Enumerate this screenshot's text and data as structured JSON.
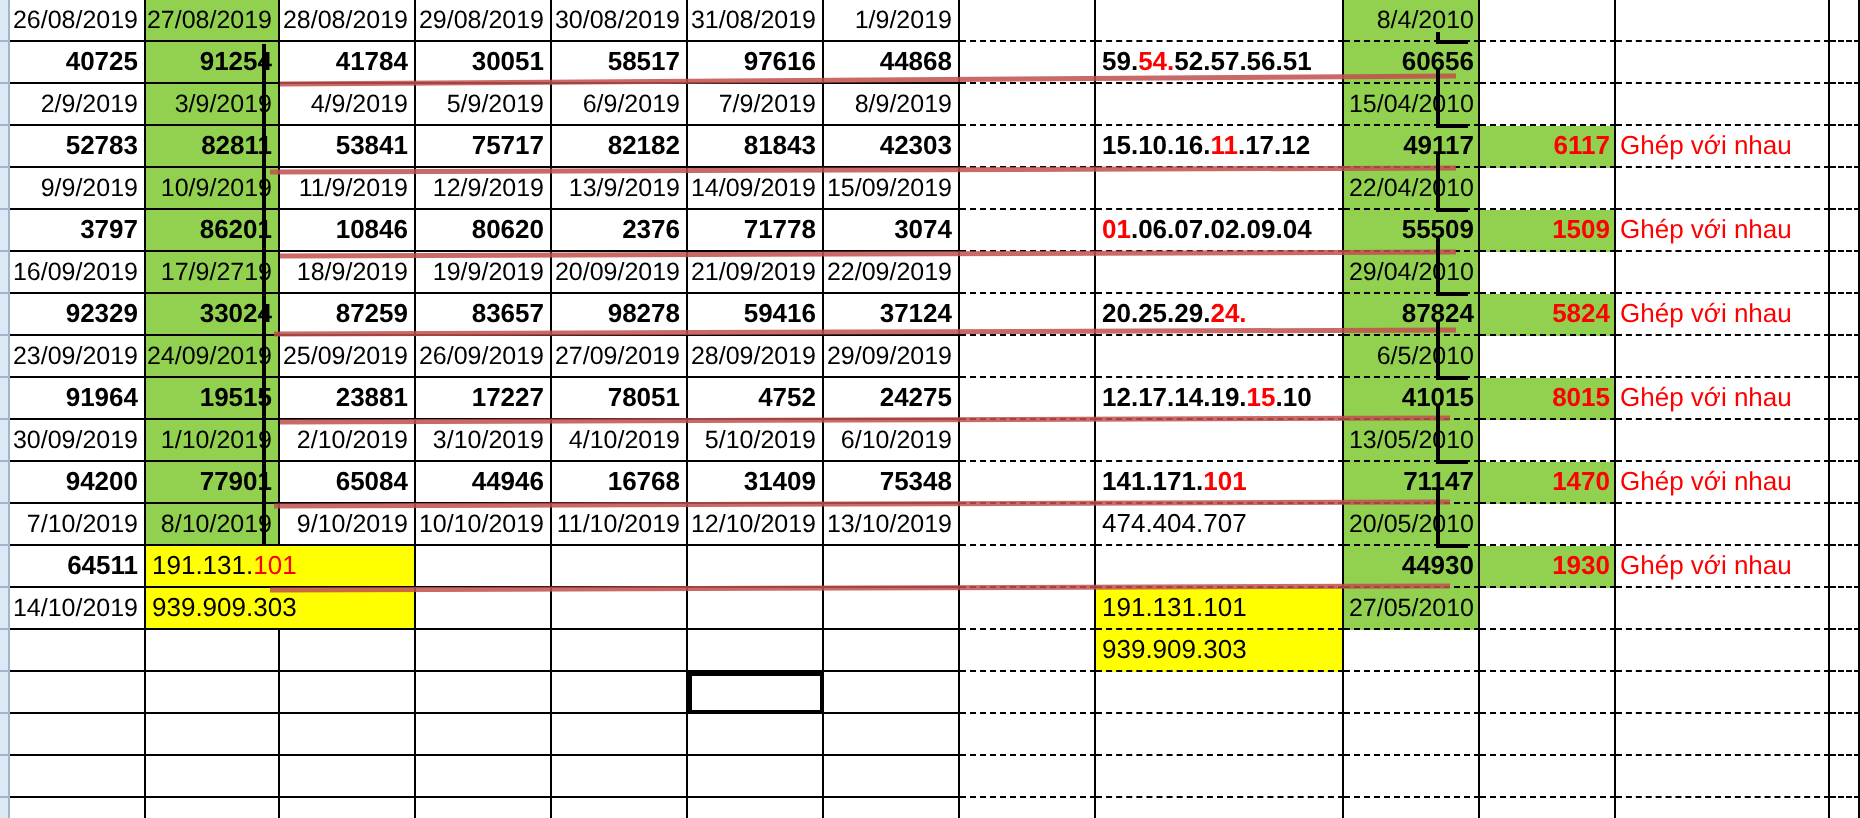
{
  "rows": [
    {
      "cells": {
        "column_1": {
          "kind": "date",
          "text": "26/08/2019"
        },
        "column_2": {
          "kind": "date",
          "text": "27/08/2019",
          "color": "#92d050"
        },
        "column_3": {
          "kind": "date",
          "text": "28/08/2019"
        },
        "column_4": {
          "kind": "date",
          "text": "29/08/2019"
        },
        "column_5": {
          "kind": "date",
          "text": "30/08/2019"
        },
        "column_6": {
          "kind": "date",
          "text": "31/08/2019"
        },
        "column_7": {
          "kind": "date",
          "text": "1/9/2019"
        },
        "column_10": {
          "kind": "date",
          "text": "8/4/2010",
          "color": "#92d050"
        }
      }
    },
    {
      "cells": {
        "column_1": {
          "kind": "number",
          "text": "40725"
        },
        "column_2": {
          "kind": "number",
          "text": "91254",
          "color": "#92d050"
        },
        "column_3": {
          "kind": "number",
          "text": "41784"
        },
        "column_4": {
          "kind": "number",
          "text": "30051"
        },
        "column_5": {
          "kind": "number",
          "text": "58517"
        },
        "column_6": {
          "kind": "number",
          "text": "97616"
        },
        "column_7": {
          "kind": "number",
          "text": "44868"
        },
        "column_9": {
          "kind": "sequence",
          "parts": [
            {
              "text": "59.",
              "red": false
            },
            {
              "text": "54.",
              "red": true
            },
            {
              "text": "52.57.56.51",
              "red": false
            }
          ]
        },
        "column_10": {
          "kind": "number",
          "text": "60656",
          "color": "#92d050"
        }
      }
    },
    {
      "cells": {
        "column_1": {
          "kind": "date",
          "text": "2/9/2019"
        },
        "column_2": {
          "kind": "date",
          "text": "3/9/2019",
          "color": "#92d050"
        },
        "column_3": {
          "kind": "date",
          "text": "4/9/2019"
        },
        "column_4": {
          "kind": "date",
          "text": "5/9/2019"
        },
        "column_5": {
          "kind": "date",
          "text": "6/9/2019"
        },
        "column_6": {
          "kind": "date",
          "text": "7/9/2019"
        },
        "column_7": {
          "kind": "date",
          "text": "8/9/2019"
        },
        "column_10": {
          "kind": "date",
          "text": "15/04/2010",
          "color": "#92d050"
        }
      }
    },
    {
      "cells": {
        "column_1": {
          "kind": "number",
          "text": "52783"
        },
        "column_2": {
          "kind": "number",
          "text": "82811",
          "color": "#92d050"
        },
        "column_3": {
          "kind": "number",
          "text": "53841"
        },
        "column_4": {
          "kind": "number",
          "text": "75717"
        },
        "column_5": {
          "kind": "number",
          "text": "82182"
        },
        "column_6": {
          "kind": "number",
          "text": "81843"
        },
        "column_7": {
          "kind": "number",
          "text": "42303"
        },
        "column_9": {
          "kind": "sequence",
          "parts": [
            {
              "text": "15.10.16.",
              "red": false
            },
            {
              "text": "11",
              "red": true
            },
            {
              "text": ".17.12",
              "red": false
            }
          ]
        },
        "column_10": {
          "kind": "number",
          "text": "49117",
          "color": "#92d050"
        },
        "column_11": {
          "kind": "count",
          "text": "6117",
          "color": "#92d050"
        },
        "column_12": {
          "kind": "note",
          "text": "Ghép với nhau"
        }
      }
    },
    {
      "cells": {
        "column_1": {
          "kind": "date",
          "text": "9/9/2019"
        },
        "column_2": {
          "kind": "date",
          "text": "10/9/2019",
          "color": "#92d050"
        },
        "column_3": {
          "kind": "date",
          "text": "11/9/2019"
        },
        "column_4": {
          "kind": "date",
          "text": "12/9/2019"
        },
        "column_5": {
          "kind": "date",
          "text": "13/9/2019"
        },
        "column_6": {
          "kind": "date",
          "text": "14/09/2019"
        },
        "column_7": {
          "kind": "date",
          "text": "15/09/2019"
        },
        "column_10": {
          "kind": "date",
          "text": "22/04/2010",
          "color": "#92d050"
        }
      }
    },
    {
      "cells": {
        "column_1": {
          "kind": "number",
          "text": "3797"
        },
        "column_2": {
          "kind": "number",
          "text": "86201",
          "color": "#92d050"
        },
        "column_3": {
          "kind": "number",
          "text": "10846"
        },
        "column_4": {
          "kind": "number",
          "text": "80620"
        },
        "column_5": {
          "kind": "number",
          "text": "2376"
        },
        "column_6": {
          "kind": "number",
          "text": "71778"
        },
        "column_7": {
          "kind": "number",
          "text": "3074"
        },
        "column_9": {
          "kind": "sequence",
          "parts": [
            {
              "text": "01",
              "red": true
            },
            {
              "text": ".06.07.02.09.04",
              "red": false
            }
          ]
        },
        "column_10": {
          "kind": "number",
          "text": "55509",
          "color": "#92d050"
        },
        "column_11": {
          "kind": "count",
          "text": "1509",
          "color": "#92d050"
        },
        "column_12": {
          "kind": "note",
          "text": "Ghép với nhau"
        }
      }
    },
    {
      "cells": {
        "column_1": {
          "kind": "date",
          "text": "16/09/2019"
        },
        "column_2": {
          "kind": "date",
          "text": "17/9/2719",
          "color": "#92d050"
        },
        "column_3": {
          "kind": "date",
          "text": "18/9/2019"
        },
        "column_4": {
          "kind": "date",
          "text": "19/9/2019"
        },
        "column_5": {
          "kind": "date",
          "text": "20/09/2019"
        },
        "column_6": {
          "kind": "date",
          "text": "21/09/2019"
        },
        "column_7": {
          "kind": "date",
          "text": "22/09/2019"
        },
        "column_10": {
          "kind": "date",
          "text": "29/04/2010",
          "color": "#92d050"
        }
      }
    },
    {
      "cells": {
        "column_1": {
          "kind": "number",
          "text": "92329"
        },
        "column_2": {
          "kind": "number",
          "text": "33024",
          "color": "#92d050"
        },
        "column_3": {
          "kind": "number",
          "text": "87259"
        },
        "column_4": {
          "kind": "number",
          "text": "83657"
        },
        "column_5": {
          "kind": "number",
          "text": "98278"
        },
        "column_6": {
          "kind": "number",
          "text": "59416"
        },
        "column_7": {
          "kind": "number",
          "text": "37124"
        },
        "column_9": {
          "kind": "sequence",
          "parts": [
            {
              "text": "20.25.29.",
              "red": false
            },
            {
              "text": "24.",
              "red": true
            }
          ]
        },
        "column_10": {
          "kind": "number",
          "text": "87824",
          "color": "#92d050"
        },
        "column_11": {
          "kind": "count",
          "text": "5824",
          "color": "#92d050"
        },
        "column_12": {
          "kind": "note",
          "text": "Ghép với nhau"
        }
      }
    },
    {
      "cells": {
        "column_1": {
          "kind": "date",
          "text": "23/09/2019"
        },
        "column_2": {
          "kind": "date",
          "text": "24/09/2019",
          "color": "#92d050"
        },
        "column_3": {
          "kind": "date",
          "text": "25/09/2019"
        },
        "column_4": {
          "kind": "date",
          "text": "26/09/2019"
        },
        "column_5": {
          "kind": "date",
          "text": "27/09/2019"
        },
        "column_6": {
          "kind": "date",
          "text": "28/09/2019"
        },
        "column_7": {
          "kind": "date",
          "text": "29/09/2019"
        },
        "column_10": {
          "kind": "date",
          "text": "6/5/2010",
          "color": "#92d050"
        }
      }
    },
    {
      "cells": {
        "column_1": {
          "kind": "number",
          "text": "91964"
        },
        "column_2": {
          "kind": "number",
          "text": "19515",
          "color": "#92d050"
        },
        "column_3": {
          "kind": "number",
          "text": "23881"
        },
        "column_4": {
          "kind": "number",
          "text": "17227"
        },
        "column_5": {
          "kind": "number",
          "text": "78051"
        },
        "column_6": {
          "kind": "number",
          "text": "4752"
        },
        "column_7": {
          "kind": "number",
          "text": "24275"
        },
        "column_9": {
          "kind": "sequence",
          "parts": [
            {
              "text": "12.17.14.19.",
              "red": false
            },
            {
              "text": "15",
              "red": true
            },
            {
              "text": ".10",
              "red": false
            }
          ]
        },
        "column_10": {
          "kind": "number",
          "text": "41015",
          "color": "#92d050"
        },
        "column_11": {
          "kind": "count",
          "text": "8015",
          "color": "#92d050"
        },
        "column_12": {
          "kind": "note",
          "text": "Ghép với nhau"
        }
      }
    },
    {
      "cells": {
        "column_1": {
          "kind": "date",
          "text": "30/09/2019"
        },
        "column_2": {
          "kind": "date",
          "text": "1/10/2019",
          "color": "#92d050"
        },
        "column_3": {
          "kind": "date",
          "text": "2/10/2019"
        },
        "column_4": {
          "kind": "date",
          "text": "3/10/2019"
        },
        "column_5": {
          "kind": "date",
          "text": "4/10/2019"
        },
        "column_6": {
          "kind": "date",
          "text": "5/10/2019"
        },
        "column_7": {
          "kind": "date",
          "text": "6/10/2019"
        },
        "column_10": {
          "kind": "date",
          "text": "13/05/2010",
          "color": "#92d050"
        }
      }
    },
    {
      "cells": {
        "column_1": {
          "kind": "number",
          "text": "94200"
        },
        "column_2": {
          "kind": "number",
          "text": "77901",
          "color": "#92d050"
        },
        "column_3": {
          "kind": "number",
          "text": "65084"
        },
        "column_4": {
          "kind": "number",
          "text": "44946"
        },
        "column_5": {
          "kind": "number",
          "text": "16768"
        },
        "column_6": {
          "kind": "number",
          "text": "31409"
        },
        "column_7": {
          "kind": "number",
          "text": "75348"
        },
        "column_9": {
          "kind": "sequence",
          "parts": [
            {
              "text": "141.171.",
              "red": false
            },
            {
              "text": "101",
              "red": true
            }
          ]
        },
        "column_10": {
          "kind": "number",
          "text": "71147",
          "color": "#92d050"
        },
        "column_11": {
          "kind": "count",
          "text": "1470",
          "color": "#92d050"
        },
        "column_12": {
          "kind": "note",
          "text": "Ghép với nhau"
        }
      }
    },
    {
      "cells": {
        "column_1": {
          "kind": "date",
          "text": "7/10/2019"
        },
        "column_2": {
          "kind": "date",
          "text": "8/10/2019",
          "color": "#92d050"
        },
        "column_3": {
          "kind": "date",
          "text": "9/10/2019"
        },
        "column_4": {
          "kind": "date",
          "text": "10/10/2019"
        },
        "column_5": {
          "kind": "date",
          "text": "11/10/2019"
        },
        "column_6": {
          "kind": "date",
          "text": "12/10/2019"
        },
        "column_7": {
          "kind": "date",
          "text": "13/10/2019"
        },
        "column_9": {
          "kind": "text",
          "parts": [
            {
              "text": "474.404.707",
              "red": false
            }
          ]
        },
        "column_10": {
          "kind": "date",
          "text": "20/05/2010",
          "color": "#92d050"
        }
      }
    },
    {
      "cells": {
        "column_1": {
          "kind": "number",
          "text": "64511"
        },
        "column_2": {
          "kind": "wide_text",
          "color": "#ffff00",
          "parts": [
            {
              "text": "191.131.",
              "red": false
            },
            {
              "text": "101",
              "red": true
            }
          ]
        },
        "column_10": {
          "kind": "number",
          "text": "44930",
          "color": "#92d050"
        },
        "column_11": {
          "kind": "count",
          "text": "1930",
          "color": "#92d050"
        },
        "column_12": {
          "kind": "note",
          "text": "Ghép với nhau"
        }
      }
    },
    {
      "cells": {
        "column_1": {
          "kind": "date",
          "text": "14/10/2019"
        },
        "column_2": {
          "kind": "wide_text",
          "color": "#ffff00",
          "parts": [
            {
              "text": "939.909.303",
              "red": false
            }
          ]
        },
        "column_9": {
          "kind": "text",
          "color": "#ffff00",
          "parts": [
            {
              "text": "191.131.101",
              "red": false
            }
          ]
        },
        "column_10": {
          "kind": "date",
          "text": "27/05/2010",
          "color": "#92d050"
        }
      }
    },
    {
      "cells": {
        "column_9": {
          "kind": "text",
          "color": "#ffff00",
          "parts": [
            {
              "text": "939.909.303",
              "red": false
            }
          ]
        }
      }
    },
    {
      "cells": {
        "column_6": {
          "kind": "empty",
          "selected": true
        }
      }
    }
  ]
}
